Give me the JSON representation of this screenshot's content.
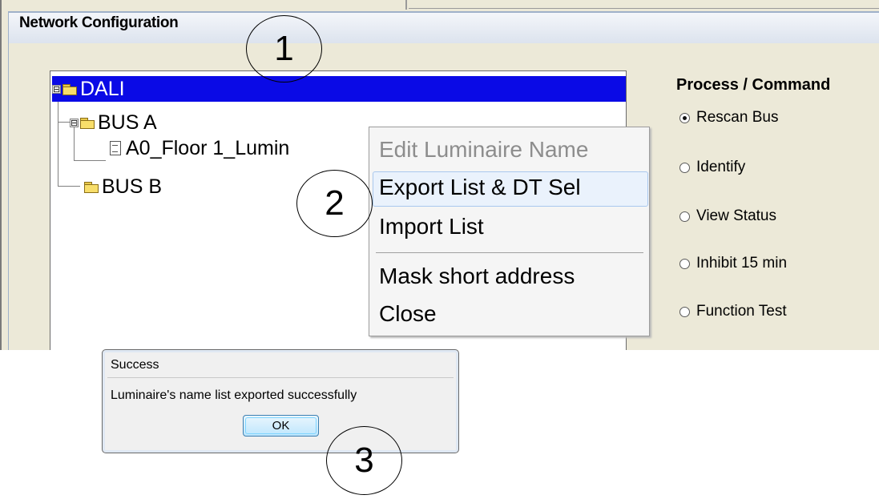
{
  "window": {
    "group_title": "Network Configuration"
  },
  "tree": {
    "root": {
      "label": "DALI",
      "icon": "folder-open-icon",
      "expander": "⊟"
    },
    "bus_a": {
      "label": "BUS A",
      "icon": "folder-open-icon",
      "expander": "⊟"
    },
    "luminaire": {
      "label": "A0_Floor 1_Lumin",
      "icon": "document-icon"
    },
    "bus_b": {
      "label": "BUS B",
      "icon": "folder-icon"
    }
  },
  "context_menu": {
    "items": [
      {
        "label": "Edit Luminaire Name",
        "enabled": false
      },
      {
        "label": "Export List & DT Sel",
        "enabled": true,
        "highlighted": true
      },
      {
        "label": "Import List",
        "enabled": true
      },
      {
        "label": "Mask short address",
        "enabled": true
      },
      {
        "label": "Close",
        "enabled": true
      }
    ]
  },
  "process_panel": {
    "title": "Process / Command",
    "options": [
      {
        "label": "Rescan Bus",
        "selected": true
      },
      {
        "label": "Identify",
        "selected": false
      },
      {
        "label": "View Status",
        "selected": false
      },
      {
        "label": "Inhibit 15 min",
        "selected": false
      },
      {
        "label": "Function Test",
        "selected": false
      }
    ]
  },
  "dialog": {
    "title": "Success",
    "message": "Luminaire's name list exported successfully",
    "ok_label": "OK"
  },
  "callouts": [
    "1",
    "2",
    "3"
  ],
  "colors": {
    "selection_bg": "#0a0ae6",
    "menu_highlight_border": "#a9c8ee"
  }
}
